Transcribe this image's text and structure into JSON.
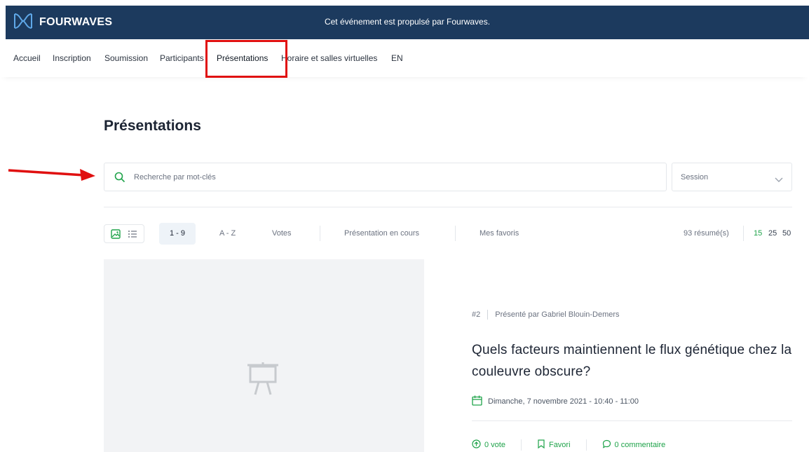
{
  "brand": {
    "name": "FOURWAVES",
    "powered_by": "Cet événement est propulsé par Fourwaves."
  },
  "nav": {
    "items": [
      {
        "label": "Accueil"
      },
      {
        "label": "Inscription"
      },
      {
        "label": "Soumission"
      },
      {
        "label": "Participants"
      },
      {
        "label": "Présentations"
      },
      {
        "label": "Horaire et salles virtuelles"
      },
      {
        "label": "EN"
      }
    ],
    "active": "Présentations"
  },
  "page": {
    "title": "Présentations"
  },
  "search": {
    "placeholder": "Recherche par mot-clés",
    "value": ""
  },
  "session_filter": {
    "label": "Session"
  },
  "toolbar": {
    "sort_options": [
      "1 - 9",
      "A - Z",
      "Votes"
    ],
    "active_sort": "1 - 9",
    "filters": [
      "Présentation en cours",
      "Mes favoris"
    ],
    "count": "93 résumé(s)",
    "per_page": [
      "15",
      "25",
      "50"
    ],
    "active_per_page": "15"
  },
  "presentation": {
    "number": "#2",
    "presenter": "Présenté par Gabriel Blouin-Demers",
    "title": "Quels facteurs maintiennent le flux génétique chez la couleuvre obscure?",
    "date": "Dimanche, 7 novembre 2021 - 10:40 - 11:00",
    "votes": "0 vote",
    "favorite": "Favori",
    "comments": "0 commentaire"
  },
  "icons": {
    "logo": "fourwaves-logo-icon",
    "search": "search-icon",
    "chevron": "chevron-down-icon",
    "grid_view": "image-icon",
    "list_view": "list-icon",
    "easel": "presentation-easel-icon",
    "calendar": "calendar-icon",
    "vote": "arrow-up-circle-icon",
    "bookmark": "bookmark-icon",
    "comment": "comment-icon"
  },
  "colors": {
    "topbar": "#1c3a5e",
    "accent": "#1fa34a",
    "annotation": "#e01010"
  }
}
